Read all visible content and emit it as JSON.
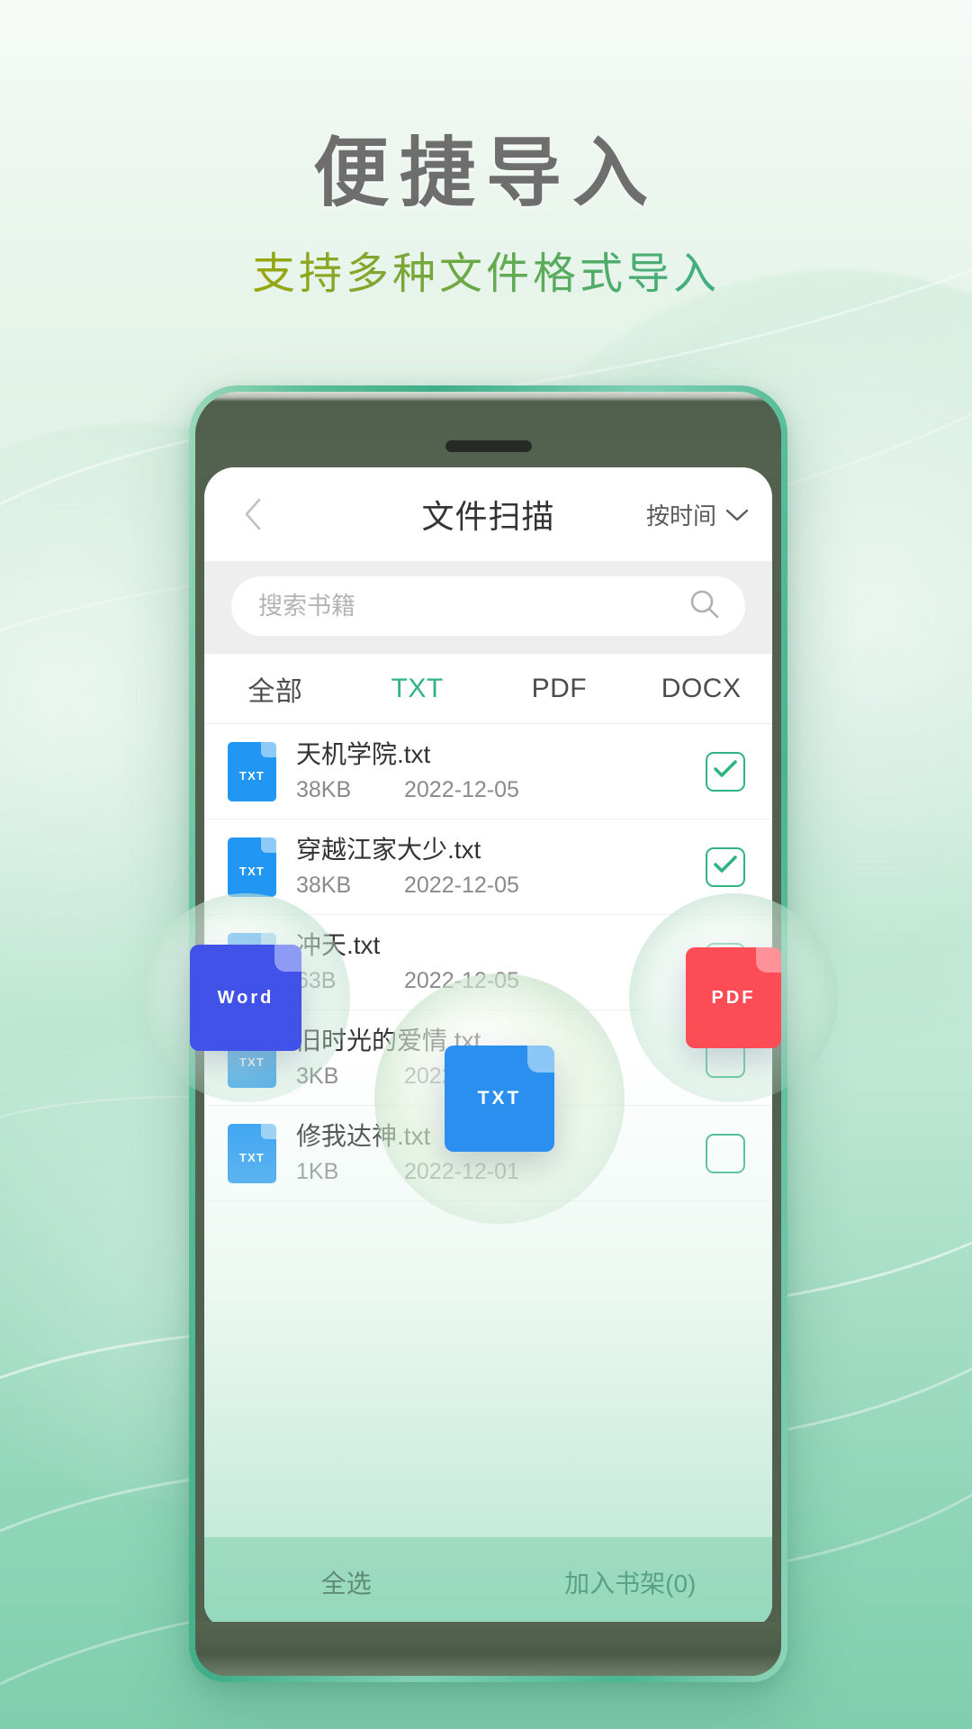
{
  "page": {
    "title": "便捷导入",
    "subtitle": "支持多种文件格式导入"
  },
  "colors": {
    "accent_green": "#2fb37f",
    "title_gray": "#6e6e6e",
    "subtitle_from": "#9aa60c",
    "subtitle_to": "#3fae86",
    "phone_frame": "#49b692",
    "bezel": "#52614e",
    "file_blue": "#2196f3",
    "word_blue": "#4152e8",
    "txt_blue": "#2b8ff0",
    "pdf_red": "#fc4d57",
    "bottom_bar": "#9fdcc2"
  },
  "app": {
    "header": {
      "back_icon": "chevron-left-icon",
      "title": "文件扫描",
      "sort_label": "按时间",
      "sort_icon": "chevron-down-icon"
    },
    "search": {
      "placeholder": "搜索书籍",
      "value": "",
      "icon": "search-icon"
    },
    "tabs": [
      {
        "label": "全部",
        "active": false
      },
      {
        "label": "TXT",
        "active": true
      },
      {
        "label": "PDF",
        "active": false
      },
      {
        "label": "DOCX",
        "active": false
      }
    ],
    "files": [
      {
        "icon_label": "TXT",
        "name": "天机学院.txt",
        "size": "38KB",
        "date": "2022-12-05",
        "checked": true
      },
      {
        "icon_label": "TXT",
        "name": "穿越江家大少.txt",
        "size": "38KB",
        "date": "2022-12-05",
        "checked": true
      },
      {
        "icon_label": "TXT",
        "name": "冲天.txt",
        "size": "63B",
        "date": "2022-12-05",
        "checked": false
      },
      {
        "icon_label": "TXT",
        "name": "旧时光的爱情.txt",
        "size": "3KB",
        "date": "2022-12-02",
        "checked": false
      },
      {
        "icon_label": "TXT",
        "name": "修我达神.txt",
        "size": "1KB",
        "date": "2022-12-01",
        "checked": false
      }
    ],
    "bottom_bar": {
      "select_all": "全选",
      "add_to_shelf": "加入书架(0)"
    }
  },
  "badges": [
    {
      "label": "Word",
      "key": "word"
    },
    {
      "label": "TXT",
      "key": "txt"
    },
    {
      "label": "PDF",
      "key": "pdf"
    }
  ]
}
